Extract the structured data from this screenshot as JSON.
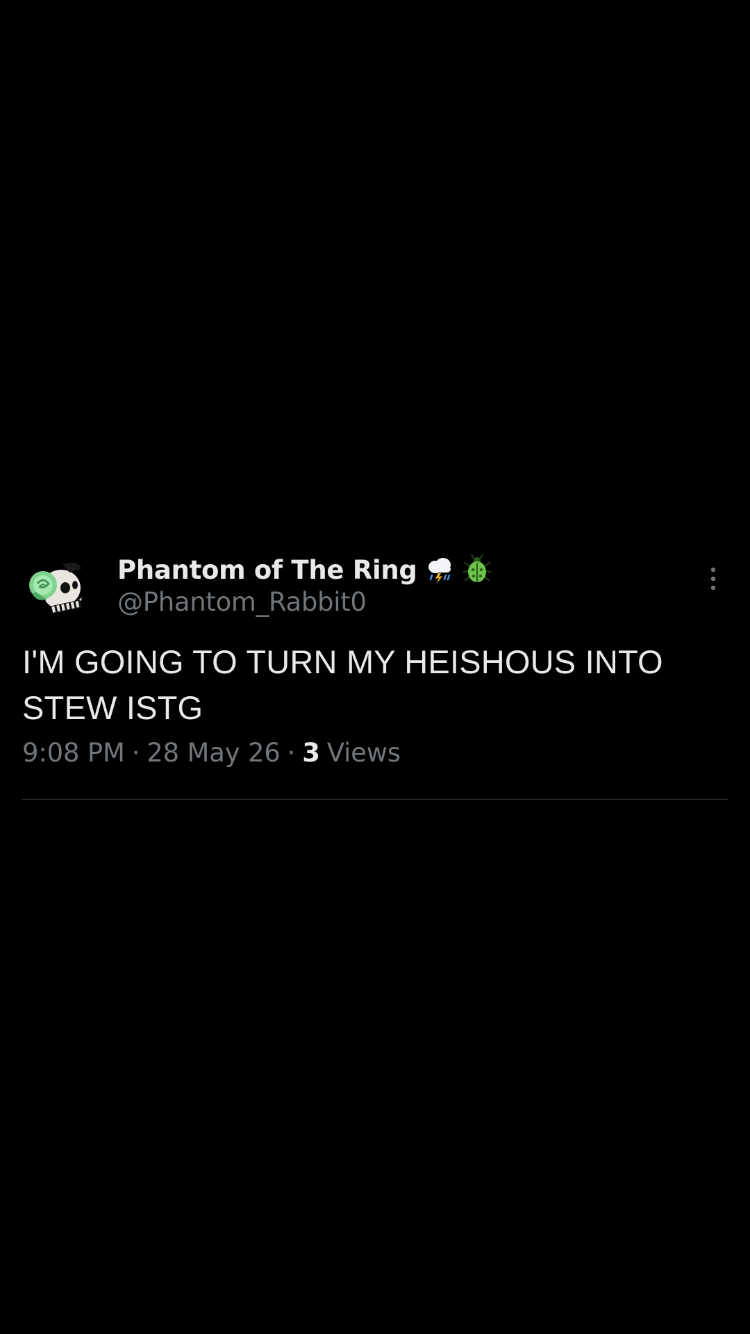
{
  "tweet": {
    "display_name": "Phantom of The Ring",
    "display_name_emojis": [
      "cloud-with-lightning-and-rain-icon",
      "beetle-icon"
    ],
    "handle": "@Phantom_Rabbit0",
    "text": "I'M GOING TO TURN MY HEISHOUS INTO\nSTEW ISTG",
    "time": "9:08 PM",
    "separator": "·",
    "date": "28 May 26",
    "views_count": "3",
    "views_label": "Views"
  },
  "colors": {
    "background": "#000000",
    "primary_text": "#e7e9ea",
    "secondary_text": "#71767b",
    "divider": "#2f3336"
  }
}
